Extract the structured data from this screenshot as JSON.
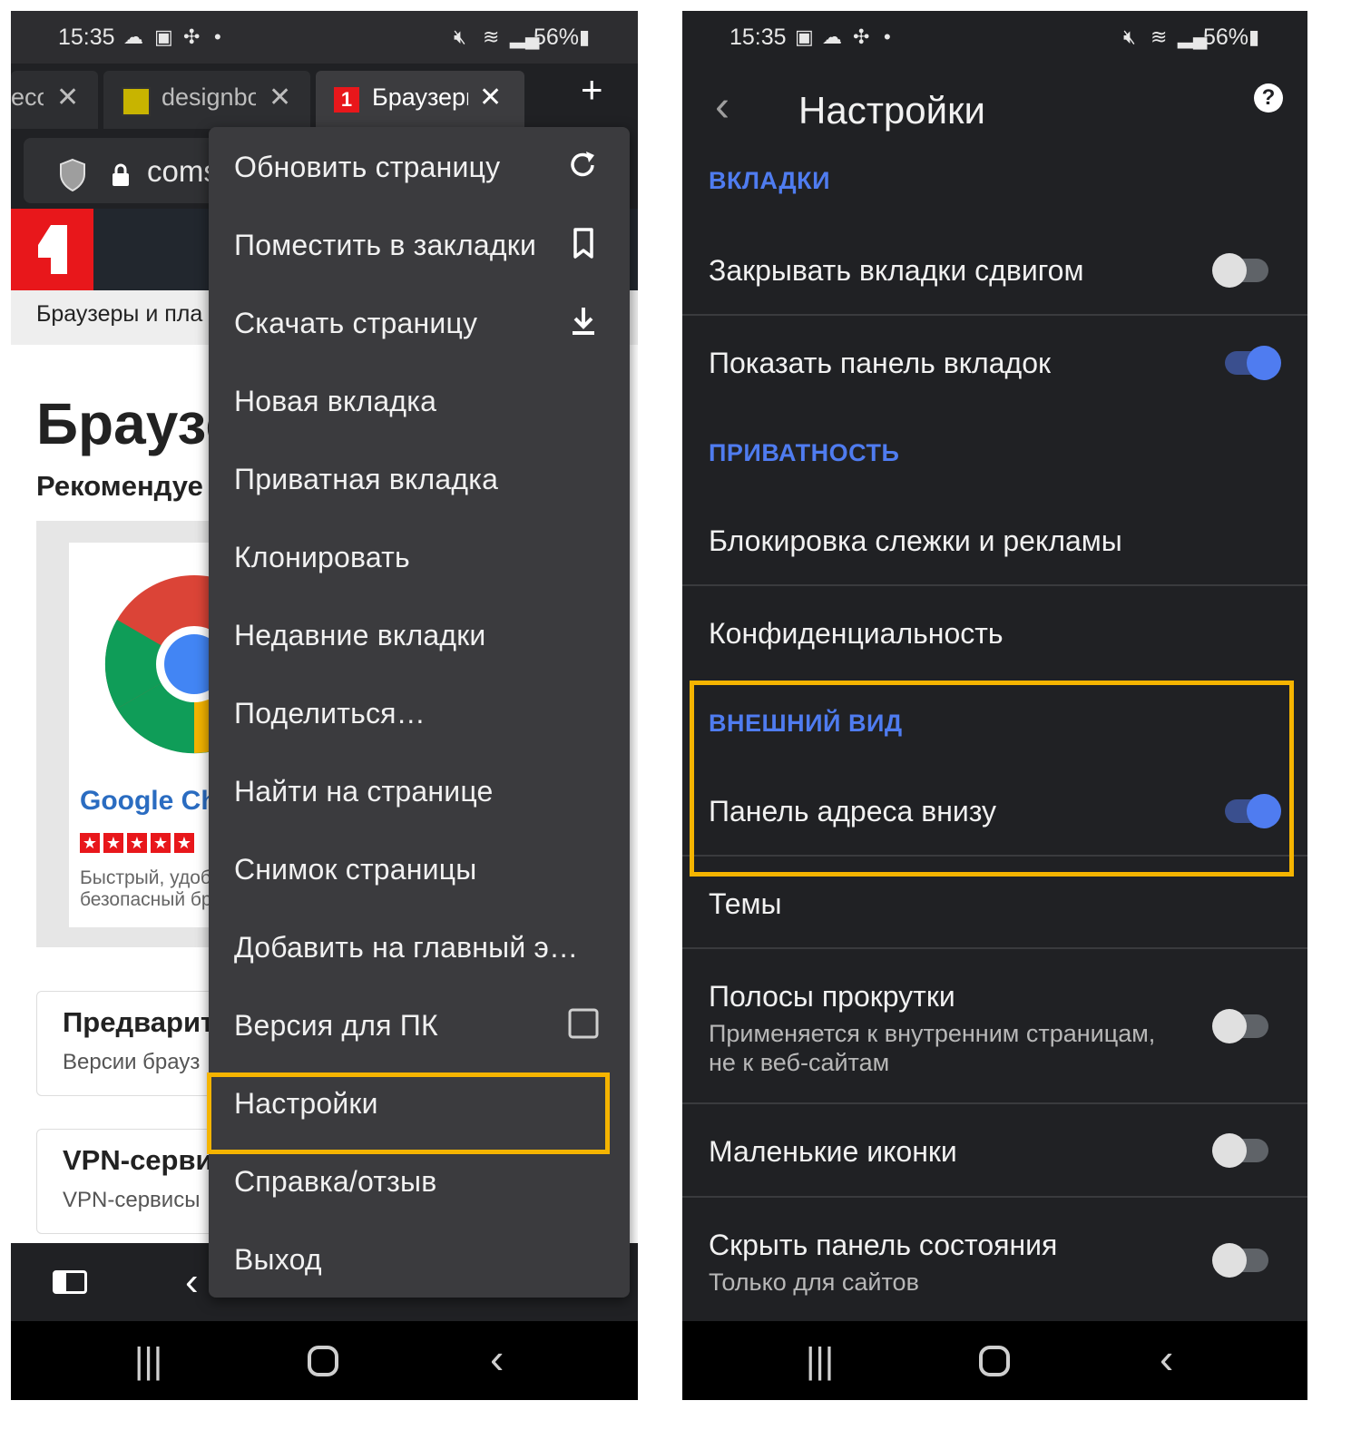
{
  "left_phone": {
    "status_bar": {
      "time": "15:35",
      "battery": "56%"
    },
    "tabs": [
      {
        "label": "eco",
        "active": false
      },
      {
        "label": "designbo",
        "active": false
      },
      {
        "label": "Браузеры",
        "active": true
      }
    ],
    "address": {
      "url": "coms"
    },
    "page": {
      "breadcrumb": "Браузеры и пла",
      "heading": "Браузе",
      "subheading": "Рекомендуе",
      "card_title": "Google Chr",
      "card_desc_1": "Быстрый, удоб",
      "card_desc_2": "безопасный бр",
      "item2_title": "Предварит",
      "item2_sub": "Версии брауз",
      "item3_title": "VPN-серви",
      "item3_sub": "VPN-сервисы"
    },
    "menu": {
      "items": [
        {
          "label": "Обновить страницу",
          "icon": "refresh-icon"
        },
        {
          "label": "Поместить в закладки",
          "icon": "bookmark-icon"
        },
        {
          "label": "Скачать страницу",
          "icon": "download-icon"
        },
        {
          "label": "Новая вкладка",
          "icon": ""
        },
        {
          "label": "Приватная вкладка",
          "icon": ""
        },
        {
          "label": "Клонировать",
          "icon": ""
        },
        {
          "label": "Недавние вкладки",
          "icon": ""
        },
        {
          "label": "Поделиться…",
          "icon": ""
        },
        {
          "label": "Найти на странице",
          "icon": ""
        },
        {
          "label": "Снимок страницы",
          "icon": ""
        },
        {
          "label": "Добавить на главный э…",
          "icon": ""
        },
        {
          "label": "Версия для ПК",
          "icon": "checkbox-icon"
        },
        {
          "label": "Настройки",
          "icon": ""
        },
        {
          "label": "Справка/отзыв",
          "icon": ""
        },
        {
          "label": "Выход",
          "icon": ""
        }
      ],
      "highlighted": "Настройки"
    }
  },
  "right_phone": {
    "status_bar": {
      "time": "15:35",
      "battery": "56%"
    },
    "title": "Настройки",
    "sections": {
      "tabs": "ВКЛАДКИ",
      "privacy": "ПРИВАТНОСТЬ",
      "appearance": "ВНЕШНИЙ ВИД"
    },
    "settings": {
      "swipe_close": {
        "label": "Закрывать вкладки сдвигом",
        "enabled": false
      },
      "tab_panel": {
        "label": "Показать панель вкладок",
        "enabled": true
      },
      "tracking": {
        "label": "Блокировка слежки и рекламы"
      },
      "confidential": {
        "label": "Конфиденциальность"
      },
      "bottom_address": {
        "label": "Панель адреса внизу",
        "enabled": true
      },
      "themes": {
        "label": "Темы"
      },
      "scrollbars": {
        "label": "Полосы прокрутки",
        "sub_1": "Применяется к внутренним страницам,",
        "sub_2": "не к веб-сайтам",
        "enabled": false
      },
      "small_icons": {
        "label": "Маленькие иконки",
        "enabled": false
      },
      "hide_status": {
        "label": "Скрыть панель состояния",
        "sub": "Только для сайтов",
        "enabled": false
      }
    }
  },
  "colors": {
    "highlight": "#f5b400",
    "accent": "#4f7cf0",
    "menu_bg": "#3b3b3e",
    "settings_bg": "#202124"
  }
}
